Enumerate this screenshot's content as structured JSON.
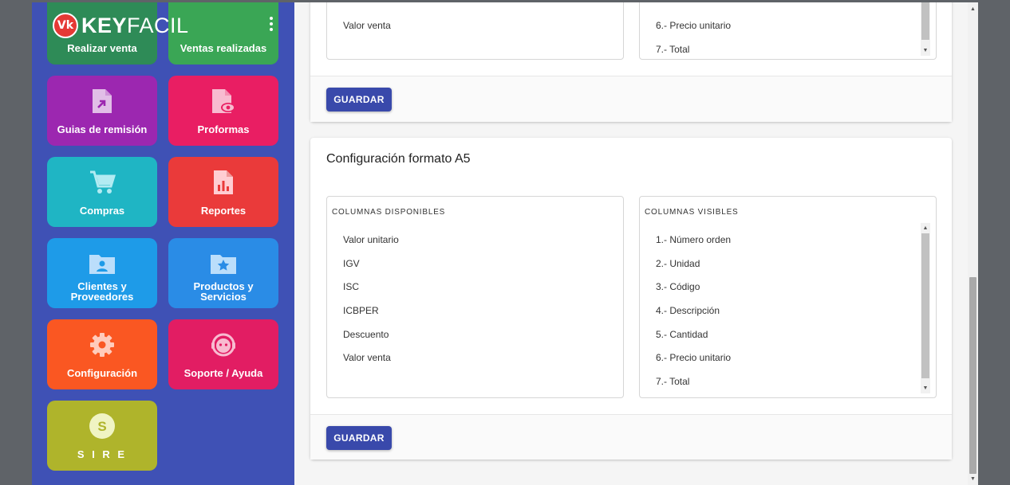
{
  "brand": {
    "mark": "Vk",
    "name_bold": "KEY",
    "name_light": "FACIL"
  },
  "sidebar": {
    "tiles": [
      {
        "label": "Realizar venta",
        "color": "#2e8b57",
        "icon": "cash-icon"
      },
      {
        "label": "Ventas realizadas",
        "color": "#3aa655",
        "icon": "list-icon"
      },
      {
        "label": "Guias de remisión",
        "color": "#9c27b0",
        "icon": "file-arrow-icon"
      },
      {
        "label": "Proformas",
        "color": "#e91e63",
        "icon": "file-eye-icon"
      },
      {
        "label": "Compras",
        "color": "#1fb5c4",
        "icon": "cart-icon"
      },
      {
        "label": "Reportes",
        "color": "#ea3a3a",
        "icon": "file-chart-icon"
      },
      {
        "label": "Clientes y Proveedores",
        "color": "#1e9be8",
        "icon": "folder-person-icon"
      },
      {
        "label": "Productos y Servicios",
        "color": "#2a8ce6",
        "icon": "folder-star-icon"
      },
      {
        "label": "Configuración",
        "color": "#fa5722",
        "icon": "gear-icon"
      },
      {
        "label": "Soporte / Ayuda",
        "color": "#e21d63",
        "icon": "support-face-icon"
      },
      {
        "label": "S I R E",
        "color": "#afb42b",
        "icon": "sire-icon",
        "icon_text": "S"
      }
    ]
  },
  "top_card": {
    "available_items": [
      "Valor venta"
    ],
    "visible_items": [
      "6.- Precio unitario",
      "7.- Total"
    ],
    "save_label": "GUARDAR"
  },
  "a5_card": {
    "title": "Configuración formato A5",
    "available_header": "COLUMNAS DISPONIBLES",
    "visible_header": "COLUMNAS VISIBLES",
    "available_items": [
      "Valor unitario",
      "IGV",
      "ISC",
      "ICBPER",
      "Descuento",
      "Valor venta"
    ],
    "visible_items": [
      "1.- Número orden",
      "2.- Unidad",
      "3.- Código",
      "4.- Descripción",
      "5.- Cantidad",
      "6.- Precio unitario",
      "7.- Total"
    ],
    "save_label": "GUARDAR"
  },
  "colors": {
    "sidebar_bg": "#3f51b5",
    "button_bg": "#3949ab"
  }
}
